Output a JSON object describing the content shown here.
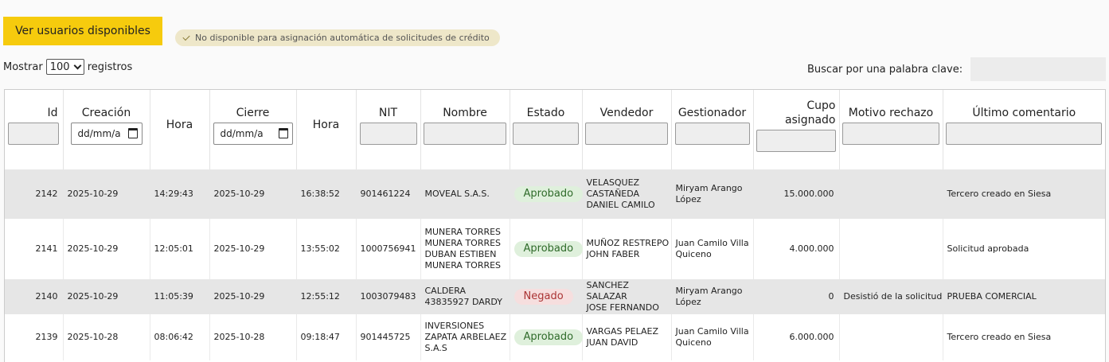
{
  "top_button": "Ver usuarios disponibles",
  "notice": "No disponible para asignación automática de solicitudes de crédito",
  "length": {
    "prefix": "Mostrar",
    "value": "100",
    "suffix": "registros"
  },
  "search": {
    "label": "Buscar por una palabra clave:"
  },
  "columns": {
    "id": "Id",
    "creacion": "Creación",
    "hora": "Hora",
    "cierre": "Cierre",
    "hora2": "Hora",
    "nit": "NIT",
    "nombre": "Nombre",
    "estado": "Estado",
    "vendedor": "Vendedor",
    "gestionador": "Gestionador",
    "cupo_1": "Cupo",
    "cupo_2": "asignado",
    "motivo": "Motivo rechazo",
    "comentario": "Último comentario"
  },
  "date_placeholder": "dd/mm/a",
  "rows": [
    {
      "id": "2142",
      "creacion": "2025-10-29",
      "hora": "14:29:43",
      "cierre": "2025-10-29",
      "hora2": "16:38:52",
      "nit": "901461224",
      "nombre": [
        "MOVEAL S.A.S."
      ],
      "estado": "Aprobado",
      "estado_type": "approved",
      "vendedor": [
        "VELASQUEZ",
        "CASTAÑEDA",
        "DANIEL CAMILO"
      ],
      "gestionador": [
        "Miryam Arango",
        "López"
      ],
      "cupo": "15.000.000",
      "motivo": "",
      "comentario": "Tercero creado en Siesa"
    },
    {
      "id": "2141",
      "creacion": "2025-10-29",
      "hora": "12:05:01",
      "cierre": "2025-10-29",
      "hora2": "13:55:02",
      "nit": "1000756941",
      "nombre": [
        "MUNERA TORRES",
        "MUNERA TORRES",
        "DUBAN ESTIBEN",
        "MUNERA TORRES"
      ],
      "estado": "Aprobado",
      "estado_type": "approved",
      "vendedor": [
        "MUÑOZ RESTREPO",
        "JOHN FABER"
      ],
      "gestionador": [
        "Juan Camilo Villa",
        "Quiceno"
      ],
      "cupo": "4.000.000",
      "motivo": "",
      "comentario": "Solicitud aprobada"
    },
    {
      "id": "2140",
      "creacion": "2025-10-29",
      "hora": "11:05:39",
      "cierre": "2025-10-29",
      "hora2": "12:55:12",
      "nit": "1003079483",
      "nombre": [
        "CALDERA",
        "43835927 DARDY"
      ],
      "estado": "Negado",
      "estado_type": "denied",
      "vendedor": [
        "SANCHEZ SALAZAR",
        "JOSE FERNANDO"
      ],
      "gestionador": [
        "Miryam Arango",
        "López"
      ],
      "cupo": "0",
      "motivo": "Desistió de la solicitud",
      "comentario": "PRUEBA COMERCIAL"
    },
    {
      "id": "2139",
      "creacion": "2025-10-28",
      "hora": "08:06:42",
      "cierre": "2025-10-28",
      "hora2": "09:18:47",
      "nit": "901445725",
      "nombre": [
        "INVERSIONES",
        "ZAPATA ARBELAEZ",
        "S.A.S"
      ],
      "estado": "Aprobado",
      "estado_type": "approved",
      "vendedor": [
        "VARGAS PELAEZ",
        "JUAN DAVID"
      ],
      "gestionador": [
        "Juan Camilo Villa",
        "Quiceno"
      ],
      "cupo": "6.000.000",
      "motivo": "",
      "comentario": "Tercero creado en Siesa"
    }
  ]
}
